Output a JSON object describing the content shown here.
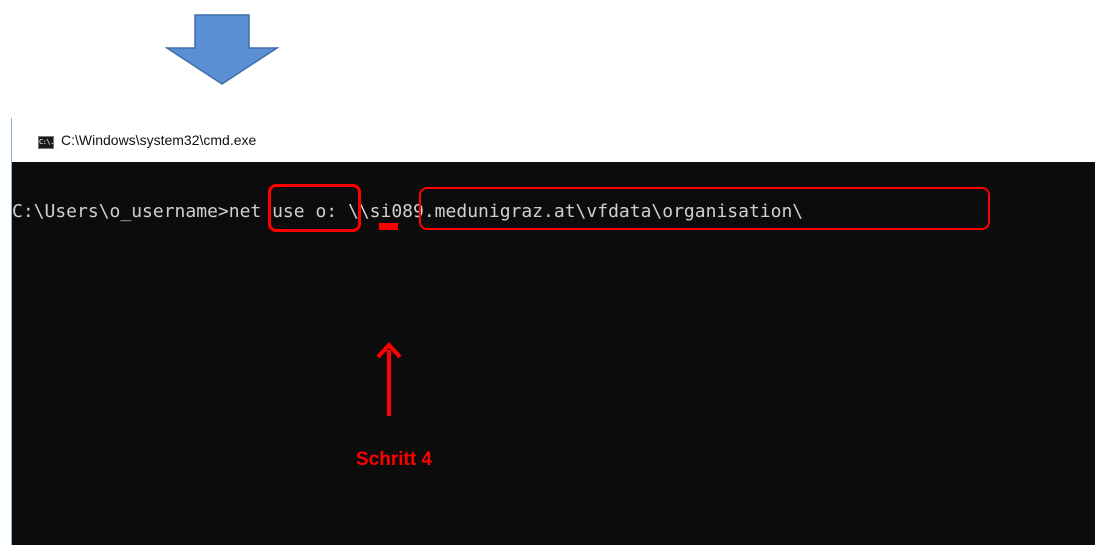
{
  "window": {
    "title": "C:\\Windows\\system32\\cmd.exe",
    "icon_name": "cmd-icon",
    "icon_text": "C:\\."
  },
  "console": {
    "prompt": "C:\\Users\\o_username>",
    "command": "net use",
    "drive": "o:",
    "path": "\\\\si089.medunigraz.at\\vfdata\\organisation\\"
  },
  "annotation": {
    "step_label": "Schritt 4",
    "highlight_color": "#ff0000",
    "arrow_color": "#5b8fd4"
  }
}
